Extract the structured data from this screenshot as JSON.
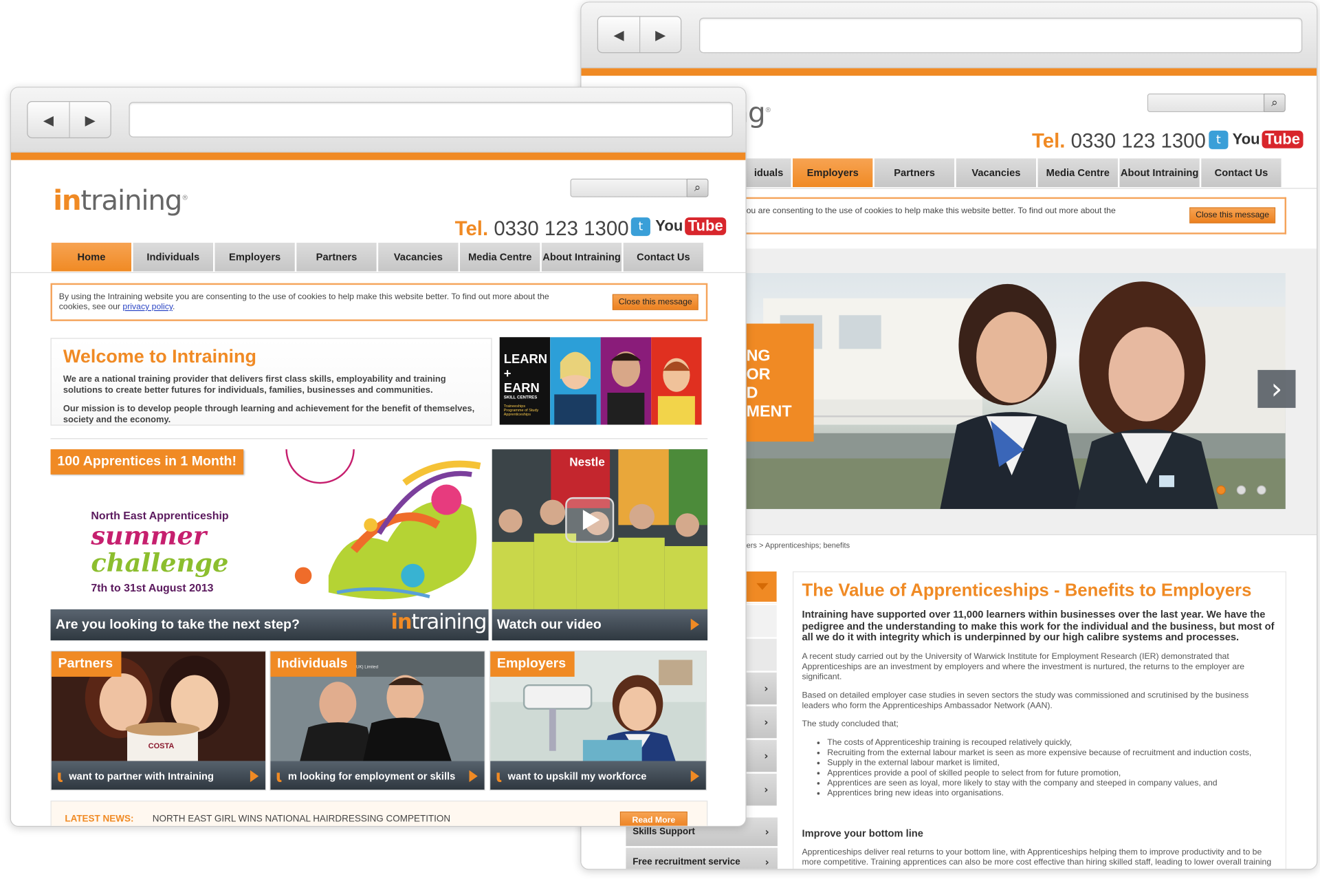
{
  "left_window": {
    "logo": {
      "in": "in",
      "rest": "training",
      "mark": "®"
    },
    "tel": {
      "prefix": "Tel.",
      "number": "0330 123 1300"
    },
    "social": {
      "twitter": "t",
      "you": "You",
      "tube": "Tube"
    },
    "nav": [
      "Home",
      "Individuals",
      "Employers",
      "Partners",
      "Vacancies",
      "Media Centre",
      "About Intraining",
      "Contact Us"
    ],
    "cookie": {
      "text1": "By using the Intraining website you are consenting to the use of cookies to help make this website better. To find out more about the",
      "text2": "cookies, see our",
      "link": "privacy policy",
      "close": "Close this message"
    },
    "welcome": {
      "title": "Welcome to Intraining",
      "p1": "We are a national training provider that delivers first class skills, employability and training solutions to create better futures for individuals, families, businesses and communities.",
      "p2": "Our mission is to develop people through learning and achievement for the benefit of themselves, society and the economy."
    },
    "learn_earn": {
      "learn": "LEARN",
      "plus": "+",
      "earn": "EARN",
      "sub": "SKILL CENTRES",
      "l1": "Traineeships",
      "l2": "Programme of Study",
      "l3": "Apprenticeships"
    },
    "promo": {
      "tag": "100 Apprentices in 1 Month!",
      "line1": "North East Apprenticeship",
      "line2": "summer",
      "line3": "challenge",
      "dates": "7th to 31st August 2013",
      "caption": "Are you looking to take the next step?",
      "caption_logo": "training",
      "caption_logo_in": "in"
    },
    "video": {
      "caption": "Watch our video",
      "brand": "Nestle"
    },
    "tiles": [
      {
        "tag": "Partners",
        "caption": "want to partner with Intraining",
        "brand": "COSTA"
      },
      {
        "tag": "Individuals",
        "caption": "m looking for employment or skills",
        "brand": "M.P Engineering (UK) Limited"
      },
      {
        "tag": "Employers",
        "caption": "want to upskill my workforce",
        "brand": ""
      }
    ],
    "news": {
      "label": "LATEST NEWS:",
      "headline": "NORTH EAST GIRL WINS NATIONAL HAIRDRESSING COMPETITION",
      "more": "Read More"
    }
  },
  "right_window": {
    "logo_partial": "ng",
    "tel": {
      "prefix": "Tel.",
      "number": "0330 123 1300"
    },
    "nav": [
      "iduals",
      "Employers",
      "Partners",
      "Vacancies",
      "Media Centre",
      "About Intraining",
      "Contact Us"
    ],
    "cookie": {
      "text1": "you are consenting to the use of cookies to help make this website better. To find out more about the",
      "link": "y",
      "close": "Close this message"
    },
    "hero_overlay": [
      "NG",
      "OR",
      "D",
      "MENT"
    ],
    "breadcrumb": "ers >  Apprenticeships; benefits",
    "sidebar": [
      {
        "label": "",
        "arrow": ""
      },
      {
        "label": "",
        "arrow": ""
      },
      {
        "label": "",
        "arrow": ""
      },
      {
        "label": "",
        "arrow": "›"
      },
      {
        "label": "",
        "arrow": "›"
      },
      {
        "label": "",
        "arrow": "›"
      },
      {
        "label": "",
        "arrow": "›"
      },
      {
        "label": "Skills Support",
        "arrow": "›"
      },
      {
        "label": "Free recruitment service",
        "arrow": "›"
      }
    ],
    "article": {
      "title": "The Value of Apprenticeships - Benefits to Employers",
      "lead": "Intraining have supported over 11,000 learners within businesses over the last year. We have the pedigree and the understanding to make this work for the individual and the business, but most of all we do it with integrity which is underpinned by our high calibre systems and processes.",
      "p1": "A recent study carried out by the University of Warwick Institute for Employment Research (IER) demonstrated that Apprenticeships are an investment by employers and where the investment is nurtured, the returns to the employer are significant.",
      "p2": "Based on detailed employer case studies in seven sectors the study was commissioned and scrutinised by the business leaders who form the Apprenticeships Ambassador Network (AAN).",
      "p3": "The study concluded that;",
      "bullets": [
        "The costs of Apprenticeship training is recouped relatively quickly,",
        "Recruiting from the external labour market is seen as more expensive because of recruitment and induction costs,",
        "Supply in the external labour market is limited,",
        "Apprentices provide a pool of skilled people to select from for future promotion,",
        "Apprentices are seen as loyal, more likely to stay with the company and steeped in company values, and",
        "Apprentices bring new ideas into organisations."
      ],
      "h3": "Improve your bottom line",
      "p4": "Apprenticeships deliver real returns to your bottom line, with Apprenticeships helping them to improve productivity and to be more competitive. Training apprentices can also be more cost effective than hiring skilled staff, leading to lower overall training"
    }
  },
  "icons": {
    "back": "◀",
    "forward": "▶",
    "search": "🔍",
    "chevron": "›"
  },
  "colors": {
    "brand_orange": "#f08a24",
    "caption_dark": "#2f3840",
    "nav_grey": "#c6c6c6"
  }
}
